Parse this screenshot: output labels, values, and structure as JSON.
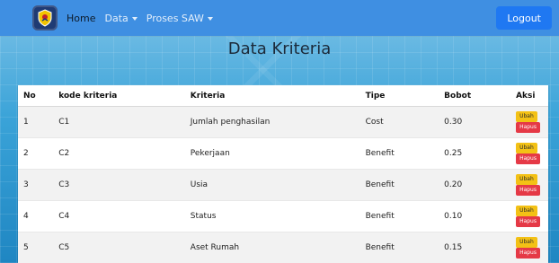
{
  "navbar": {
    "home_label": "Home",
    "data_label": "Data",
    "proses_label": "Proses SAW",
    "logout_label": "Logout"
  },
  "page": {
    "title": "Data Kriteria"
  },
  "table": {
    "headers": [
      "No",
      "kode kriteria",
      "Kriteria",
      "Tipe",
      "Bobot",
      "Aksi"
    ],
    "rows": [
      {
        "no": "1",
        "kode": "C1",
        "kriteria": "Jumlah penghasilan",
        "tipe": "Cost",
        "bobot": "0.30"
      },
      {
        "no": "2",
        "kode": "C2",
        "kriteria": "Pekerjaan",
        "tipe": "Benefit",
        "bobot": "0.25"
      },
      {
        "no": "3",
        "kode": "C3",
        "kriteria": "Usia",
        "tipe": "Benefit",
        "bobot": "0.20"
      },
      {
        "no": "4",
        "kode": "C4",
        "kriteria": "Status",
        "tipe": "Benefit",
        "bobot": "0.10"
      },
      {
        "no": "5",
        "kode": "C5",
        "kriteria": "Aset Rumah",
        "tipe": "Benefit",
        "bobot": "0.15"
      }
    ],
    "action_labels": {
      "ubah": "Ubah",
      "hapus": "Hapus"
    }
  },
  "colors": {
    "navbar": "#3f8fe2",
    "logout_button": "#1f78f2",
    "ubah_button": "#f3c115",
    "hapus_button": "#e53946"
  },
  "icons": {
    "logo": "shield-emblem-icon",
    "dropdown": "caret-down-icon"
  }
}
